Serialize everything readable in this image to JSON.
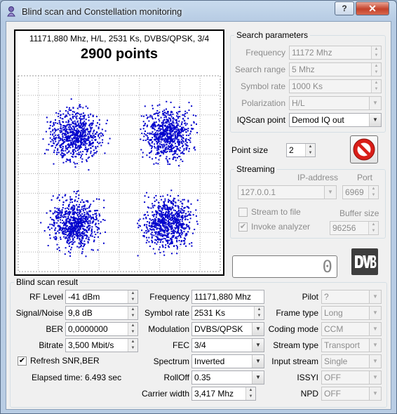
{
  "window": {
    "title": "Blind scan and Constellation monitoring",
    "help_label": "?",
    "close_label": "✕"
  },
  "constellation": {
    "info": "11171,880 Mhz, H/L, 2531 Ks, DVBS/QPSK, 3/4",
    "points_label": "2900 points",
    "point_color": "#0000cc"
  },
  "search": {
    "legend": "Search parameters",
    "frequency_label": "Frequency",
    "frequency_value": "11172 Mhz",
    "range_label": "Search range",
    "range_value": "5 Mhz",
    "symbol_label": "Symbol rate",
    "symbol_value": "1000 Ks",
    "polarization_label": "Polarization",
    "polarization_value": "H/L",
    "iqscan_label": "IQScan point",
    "iqscan_value": "Demod IQ out"
  },
  "point_size": {
    "label": "Point size",
    "value": "2"
  },
  "streaming": {
    "legend": "Streaming",
    "ip_header": "IP-address",
    "port_header": "Port",
    "ip_value": "127.0.0.1",
    "port_value": "6969",
    "stream_to_file": "Stream to file",
    "invoke_analyzer": "Invoke analyzer",
    "buffer_label": "Buffer size",
    "buffer_value": "96256"
  },
  "readout": {
    "value": "0"
  },
  "result": {
    "legend": "Blind scan result",
    "rf_label": "RF Level",
    "rf_value": "-41 dBm",
    "snr_label": "Signal/Noise",
    "snr_value": "9,8 dB",
    "ber_label": "BER",
    "ber_value": "0,0000000",
    "bitrate_label": "Bitrate",
    "bitrate_value": "3,500 Mbit/s",
    "refresh_label": "Refresh SNR,BER",
    "elapsed": "Elapsed time: 6.493 sec",
    "freq_label": "Frequency",
    "freq_value": "11171,880 Mhz",
    "sr_label": "Symbol rate",
    "sr_value": "2531 Ks",
    "mod_label": "Modulation",
    "mod_value": "DVBS/QPSK",
    "fec_label": "FEC",
    "fec_value": "3/4",
    "spectrum_label": "Spectrum",
    "spectrum_value": "Inverted",
    "rolloff_label": "RollOff",
    "rolloff_value": "0.35",
    "cw_label": "Carrier width",
    "cw_value": "3,417 Mhz",
    "pilot_label": "Pilot",
    "pilot_value": "?",
    "frame_label": "Frame type",
    "frame_value": "Long",
    "coding_label": "Coding mode",
    "coding_value": "CCM",
    "stream_type_label": "Stream type",
    "stream_type_value": "Transport",
    "input_stream_label": "Input stream",
    "input_stream_value": "Single",
    "issyi_label": "ISSYI",
    "issyi_value": "OFF",
    "npd_label": "NPD",
    "npd_value": "OFF"
  }
}
